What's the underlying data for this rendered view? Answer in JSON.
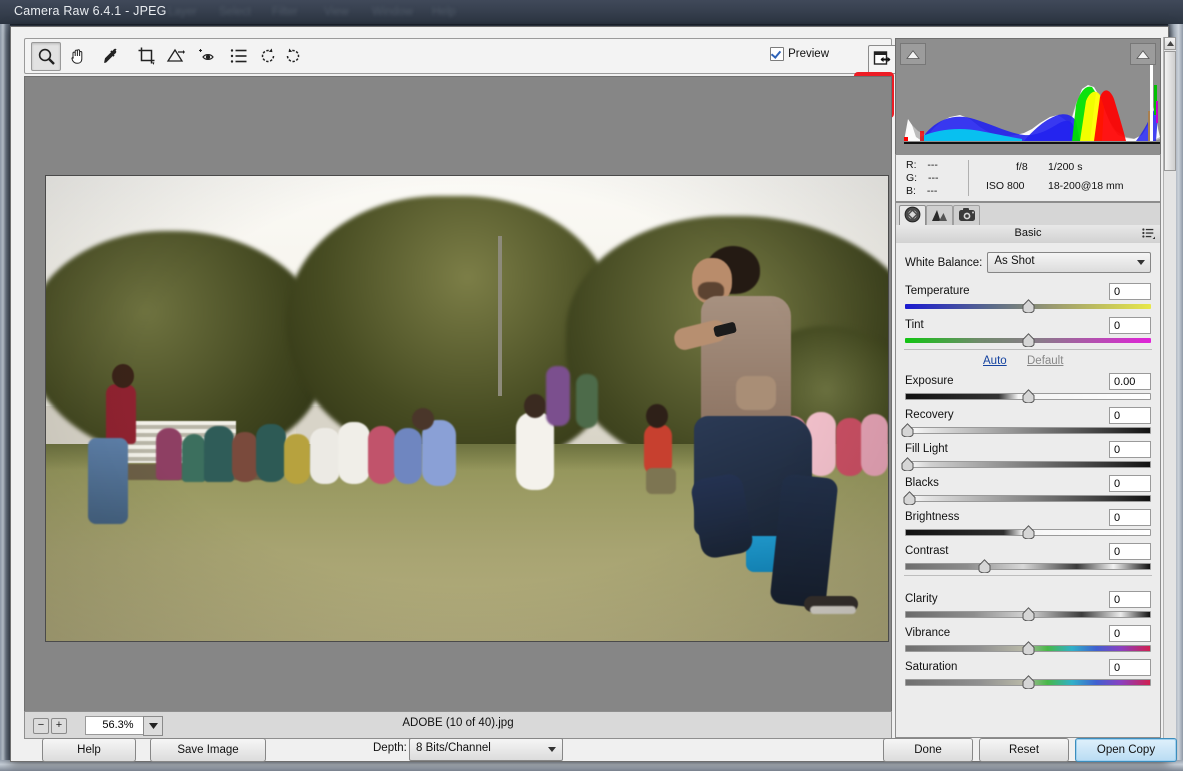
{
  "photoshop": {
    "title": "Camera Raw 6.4.1  -  JPEG",
    "menus": [
      "Layer",
      "Select",
      "Filter",
      "View",
      "Window",
      "Help"
    ]
  },
  "toolbar": {
    "tools": [
      {
        "name": "zoom-tool",
        "icon": "magnifier-icon",
        "selected": true
      },
      {
        "name": "hand-tool",
        "icon": "hand-icon",
        "selected": false
      },
      {
        "name": "white-balance-tool",
        "icon": "eyedropper-icon",
        "selected": false
      },
      {
        "name": "crop-tool",
        "icon": "crop-icon",
        "selected": false
      },
      {
        "name": "straighten-tool",
        "icon": "straighten-icon",
        "selected": false
      },
      {
        "name": "spot-removal-tool",
        "icon": "red-eye-icon",
        "selected": false
      },
      {
        "name": "preferences-tool",
        "icon": "list-icon",
        "selected": false
      },
      {
        "name": "rotate-counterclockwise-tool",
        "icon": "rotate-ccw-icon",
        "selected": false
      },
      {
        "name": "rotate-clockwise-tool",
        "icon": "rotate-cw-icon",
        "selected": false
      }
    ],
    "preview_label": "Preview",
    "preview_checked": true,
    "fullscreen_icon": "fullscreen-toggle-icon",
    "annotation_color": "#ed1c24"
  },
  "status": {
    "zoom_out_label": "−",
    "zoom_in_label": "+",
    "zoom_value": "56.3%",
    "filename": "ADOBE (10 of 40).jpg"
  },
  "histogram": {
    "shadow_clip_icon": "shadow-clipping-triangle",
    "highlight_clip_icon": "highlight-clipping-triangle"
  },
  "readout": {
    "r_label": "R:",
    "r_value": "---",
    "g_label": "G:",
    "g_value": "---",
    "b_label": "B:",
    "b_value": "---",
    "aperture": "f/8",
    "shutter": "1/200 s",
    "iso": "ISO 800",
    "lens": "18-200@18 mm"
  },
  "panel": {
    "tabs": [
      {
        "name": "tab-basic",
        "icon": "aperture-icon",
        "active": true
      },
      {
        "name": "tab-tone-curve",
        "icon": "curve-icon",
        "active": false
      },
      {
        "name": "tab-camera-calibration",
        "icon": "camera-icon",
        "active": false
      }
    ],
    "title": "Basic",
    "menu_icon": "panel-menu-icon",
    "white_balance_label": "White Balance:",
    "white_balance_value": "As Shot",
    "auto_label": "Auto",
    "default_label": "Default",
    "sliders": [
      {
        "label": "Temperature",
        "value": "0",
        "pos": 50
      },
      {
        "label": "Tint",
        "value": "0",
        "pos": 50
      },
      {
        "label": "Exposure",
        "value": "0.00",
        "pos": 50
      },
      {
        "label": "Recovery",
        "value": "0",
        "pos": 0
      },
      {
        "label": "Fill Light",
        "value": "0",
        "pos": 0
      },
      {
        "label": "Blacks",
        "value": "0",
        "pos": 2
      },
      {
        "label": "Brightness",
        "value": "0",
        "pos": 50
      },
      {
        "label": "Contrast",
        "value": "0",
        "pos": 32
      },
      {
        "label": "Clarity",
        "value": "0",
        "pos": 50
      },
      {
        "label": "Vibrance",
        "value": "0",
        "pos": 50
      },
      {
        "label": "Saturation",
        "value": "0",
        "pos": 50
      }
    ]
  },
  "footer": {
    "help_label": "Help",
    "save_image_label": "Save Image",
    "depth_label": "Depth:",
    "depth_value": "8 Bits/Channel",
    "done_label": "Done",
    "reset_label": "Reset",
    "open_copy_label": "Open Copy"
  },
  "photo": {
    "description": "Outdoor daytime photograph: a bearded man in a tan t-shirt and dark blue jeans running across a dry grass lawn, with a seated crowd of people in colourful clothing, children, trees and a white building in the background under a bright overcast sky."
  }
}
